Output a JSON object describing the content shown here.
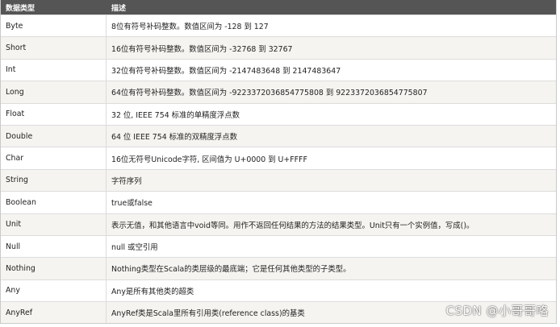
{
  "table": {
    "headers": {
      "type": "数据类型",
      "desc": "描述"
    },
    "rows": [
      {
        "type": "Byte",
        "desc": "8位有符号补码整数。数值区间为 -128 到 127"
      },
      {
        "type": "Short",
        "desc": "16位有符号补码整数。数值区间为 -32768 到 32767"
      },
      {
        "type": "Int",
        "desc": "32位有符号补码整数。数值区间为 -2147483648 到 2147483647"
      },
      {
        "type": "Long",
        "desc": "64位有符号补码整数。数值区间为 -9223372036854775808 到 9223372036854775807"
      },
      {
        "type": "Float",
        "desc": "32 位, IEEE 754 标准的单精度浮点数"
      },
      {
        "type": "Double",
        "desc": "64 位 IEEE 754 标准的双精度浮点数"
      },
      {
        "type": "Char",
        "desc": "16位无符号Unicode字符, 区间值为 U+0000 到 U+FFFF"
      },
      {
        "type": "String",
        "desc": "字符序列"
      },
      {
        "type": "Boolean",
        "desc": "true或false"
      },
      {
        "type": "Unit",
        "desc": "表示无值，和其他语言中void等同。用作不返回任何结果的方法的结果类型。Unit只有一个实例值，写成()。"
      },
      {
        "type": "Null",
        "desc": "null 或空引用"
      },
      {
        "type": "Nothing",
        "desc": "Nothing类型在Scala的类层级的最底端；它是任何其他类型的子类型。"
      },
      {
        "type": "Any",
        "desc": "Any是所有其他类的超类"
      },
      {
        "type": "AnyRef",
        "desc": "AnyRef类是Scala里所有引用类(reference class)的基类"
      }
    ]
  },
  "watermark": "CSDN @小哥哥咯"
}
